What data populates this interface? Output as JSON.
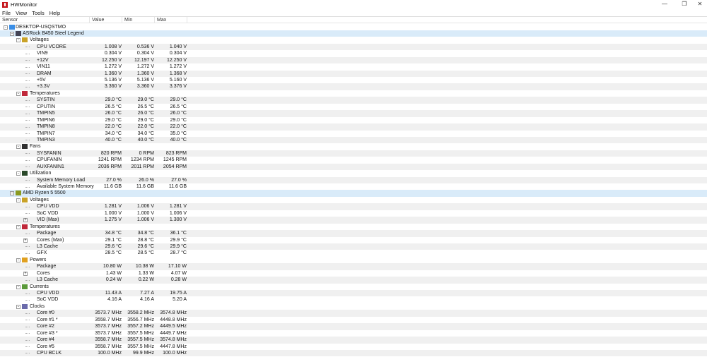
{
  "window": {
    "title": "HWMonitor",
    "menu": [
      "File",
      "View",
      "Tools",
      "Help"
    ],
    "controls": {
      "minimize": "—",
      "maximize": "❐",
      "close": "✕"
    }
  },
  "columns": [
    "Sensor",
    "Value",
    "Min",
    "Max"
  ],
  "rows": [
    {
      "level": 0,
      "label": "DESKTOP-USQSTMO",
      "icon": "computer-icon",
      "exp": "-"
    },
    {
      "level": 1,
      "label": "ASRock B450 Steel Legend",
      "icon": "motherboard-icon",
      "exp": "-",
      "sel": true
    },
    {
      "level": 2,
      "label": "Voltages",
      "icon": "voltage-icon",
      "exp": "-"
    },
    {
      "level": 3,
      "label": "CPU VCORE",
      "v": [
        "1.008 V",
        "0.536 V",
        "1.040 V"
      ]
    },
    {
      "level": 3,
      "label": "VIN9",
      "v": [
        "0.304 V",
        "0.304 V",
        "0.304 V"
      ]
    },
    {
      "level": 3,
      "label": "+12V",
      "v": [
        "12.250 V",
        "12.197 V",
        "12.250 V"
      ]
    },
    {
      "level": 3,
      "label": "VIN11",
      "v": [
        "1.272 V",
        "1.272 V",
        "1.272 V"
      ]
    },
    {
      "level": 3,
      "label": "DRAM",
      "v": [
        "1.360 V",
        "1.360 V",
        "1.368 V"
      ]
    },
    {
      "level": 3,
      "label": "+5V",
      "v": [
        "5.136 V",
        "5.136 V",
        "5.160 V"
      ]
    },
    {
      "level": 3,
      "label": "+3.3V",
      "v": [
        "3.360 V",
        "3.360 V",
        "3.376 V"
      ]
    },
    {
      "level": 2,
      "label": "Temperatures",
      "icon": "thermometer-icon",
      "exp": "-"
    },
    {
      "level": 3,
      "label": "SYSTIN",
      "v": [
        "29.0 °C",
        "29.0 °C",
        "29.0 °C"
      ]
    },
    {
      "level": 3,
      "label": "CPUTIN",
      "v": [
        "26.5 °C",
        "26.5 °C",
        "26.5 °C"
      ]
    },
    {
      "level": 3,
      "label": "TMPIN5",
      "v": [
        "26.0 °C",
        "26.0 °C",
        "26.0 °C"
      ]
    },
    {
      "level": 3,
      "label": "TMPIN6",
      "v": [
        "29.0 °C",
        "29.0 °C",
        "29.0 °C"
      ]
    },
    {
      "level": 3,
      "label": "TMPIN8",
      "v": [
        "22.0 °C",
        "22.0 °C",
        "22.0 °C"
      ]
    },
    {
      "level": 3,
      "label": "TMPIN7",
      "v": [
        "34.0 °C",
        "34.0 °C",
        "35.0 °C"
      ]
    },
    {
      "level": 3,
      "label": "TMPIN3",
      "v": [
        "40.0 °C",
        "40.0 °C",
        "40.0 °C"
      ]
    },
    {
      "level": 2,
      "label": "Fans",
      "icon": "fan-icon",
      "exp": "-"
    },
    {
      "level": 3,
      "label": "SYSFANIN",
      "v": [
        "820 RPM",
        "0 RPM",
        "823 RPM"
      ]
    },
    {
      "level": 3,
      "label": "CPUFANIN",
      "v": [
        "1241 RPM",
        "1234 RPM",
        "1245 RPM"
      ]
    },
    {
      "level": 3,
      "label": "AUXFANIN1",
      "v": [
        "2036 RPM",
        "2011 RPM",
        "2054 RPM"
      ]
    },
    {
      "level": 2,
      "label": "Utilization",
      "icon": "utilization-icon",
      "exp": "-"
    },
    {
      "level": 3,
      "label": "System Memory Load",
      "v": [
        "27.0 %",
        "26.0 %",
        "27.0 %"
      ]
    },
    {
      "level": 3,
      "label": "Available System Memory",
      "v": [
        "11.6 GB",
        "11.6 GB",
        "11.6 GB"
      ]
    },
    {
      "level": 1,
      "label": "AMD Ryzen 5 5500",
      "icon": "cpu-icon",
      "exp": "-",
      "sel": true
    },
    {
      "level": 2,
      "label": "Voltages",
      "icon": "voltage-icon",
      "exp": "-"
    },
    {
      "level": 3,
      "label": "CPU VDD",
      "v": [
        "1.281 V",
        "1.006 V",
        "1.281 V"
      ]
    },
    {
      "level": 3,
      "label": "SoC VDD",
      "v": [
        "1.000 V",
        "1.000 V",
        "1.006 V"
      ]
    },
    {
      "level": 3,
      "label": "VID (Max)",
      "v": [
        "1.275 V",
        "1.006 V",
        "1.300 V"
      ],
      "exp": "+"
    },
    {
      "level": 2,
      "label": "Temperatures",
      "icon": "thermometer-icon",
      "exp": "-"
    },
    {
      "level": 3,
      "label": "Package",
      "v": [
        "34.8 °C",
        "34.8 °C",
        "36.1 °C"
      ]
    },
    {
      "level": 3,
      "label": "Cores (Max)",
      "v": [
        "29.1 °C",
        "28.8 °C",
        "29.9 °C"
      ],
      "exp": "+"
    },
    {
      "level": 3,
      "label": "L3 Cache",
      "v": [
        "29.6 °C",
        "29.6 °C",
        "29.9 °C"
      ]
    },
    {
      "level": 3,
      "label": "GFX",
      "v": [
        "28.5 °C",
        "28.5 °C",
        "28.7 °C"
      ]
    },
    {
      "level": 2,
      "label": "Powers",
      "icon": "power-icon",
      "exp": "-"
    },
    {
      "level": 3,
      "label": "Package",
      "v": [
        "10.80 W",
        "10.38 W",
        "17.10 W"
      ]
    },
    {
      "level": 3,
      "label": "Cores",
      "v": [
        "1.43 W",
        "1.33 W",
        "4.07 W"
      ],
      "exp": "+"
    },
    {
      "level": 3,
      "label": "L3 Cache",
      "v": [
        "0.24 W",
        "0.22 W",
        "0.28 W"
      ]
    },
    {
      "level": 2,
      "label": "Currents",
      "icon": "current-icon",
      "exp": "-"
    },
    {
      "level": 3,
      "label": "CPU VDD",
      "v": [
        "11.43 A",
        "7.27 A",
        "19.75 A"
      ]
    },
    {
      "level": 3,
      "label": "SoC VDD",
      "v": [
        "4.16 A",
        "4.16 A",
        "5.20 A"
      ]
    },
    {
      "level": 2,
      "label": "Clocks",
      "icon": "clock-icon",
      "exp": "-"
    },
    {
      "level": 3,
      "label": "Core #0",
      "v": [
        "3573.7 MHz",
        "3558.2 MHz",
        "3574.8 MHz"
      ]
    },
    {
      "level": 3,
      "label": "Core #1 *",
      "v": [
        "3558.7 MHz",
        "3556.7 MHz",
        "4448.8 MHz"
      ]
    },
    {
      "level": 3,
      "label": "Core #2",
      "v": [
        "3573.7 MHz",
        "3557.2 MHz",
        "4449.5 MHz"
      ]
    },
    {
      "level": 3,
      "label": "Core #3 *",
      "v": [
        "3573.7 MHz",
        "3557.5 MHz",
        "4449.7 MHz"
      ]
    },
    {
      "level": 3,
      "label": "Core #4",
      "v": [
        "3558.7 MHz",
        "3557.5 MHz",
        "3574.8 MHz"
      ]
    },
    {
      "level": 3,
      "label": "Core #5",
      "v": [
        "3558.7 MHz",
        "3557.5 MHz",
        "4447.8 MHz"
      ]
    },
    {
      "level": 3,
      "label": "CPU BCLK",
      "v": [
        "100.0 MHz",
        "99.9 MHz",
        "100.0 MHz"
      ]
    }
  ]
}
